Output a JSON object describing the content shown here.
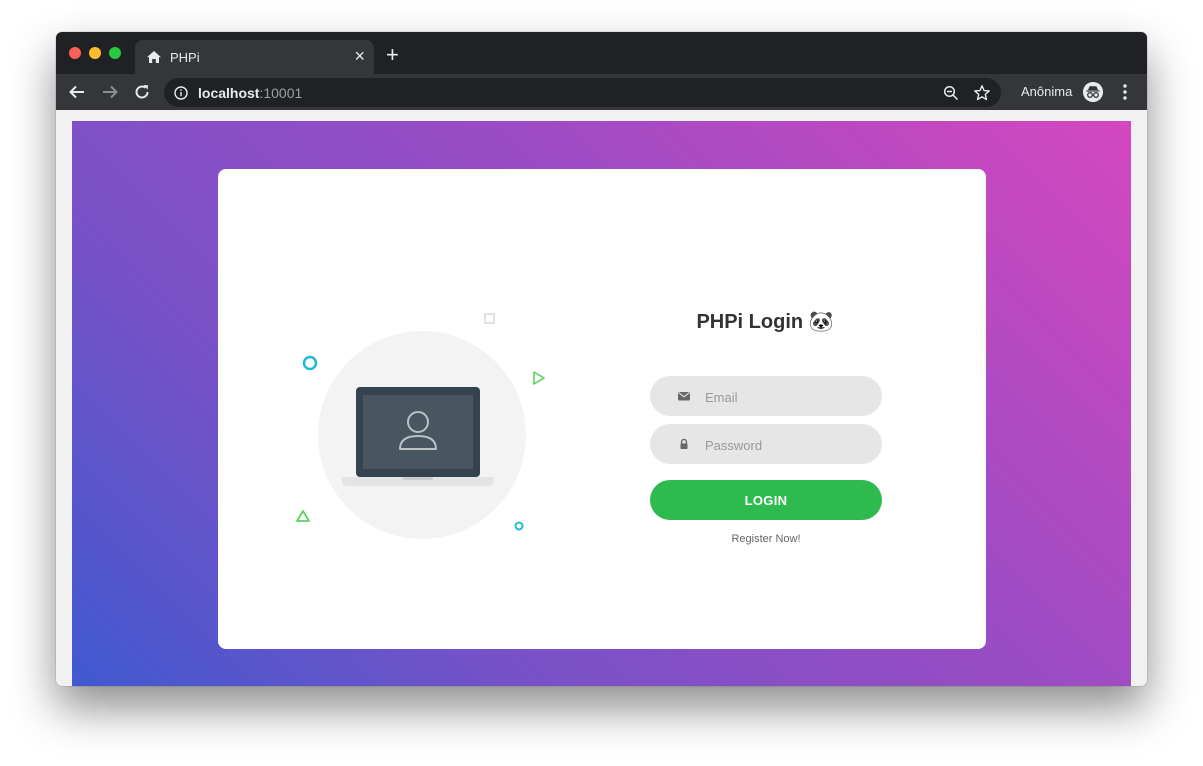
{
  "browser": {
    "tab_title": "PHPi",
    "tab_close": "×",
    "new_tab": "+",
    "url_host": "localhost",
    "url_port": ":10001",
    "profile_name": "Anônima"
  },
  "login": {
    "title": "PHPi Login 🐼",
    "email_placeholder": "Email",
    "password_placeholder": "Password",
    "login_button": "LOGIN",
    "register_link": "Register Now!"
  },
  "colors": {
    "accent": "#2fba50",
    "gradient_start": "#4059d0",
    "gradient_end": "#d447bf",
    "card": "#ffffff"
  },
  "icons": [
    "home-icon",
    "back-arrow-icon",
    "forward-arrow-icon",
    "reload-icon",
    "info-icon",
    "zoom-out-icon",
    "star-icon",
    "incognito-icon",
    "more-vert-icon",
    "envelope-icon",
    "lock-icon",
    "laptop-user-icon"
  ]
}
